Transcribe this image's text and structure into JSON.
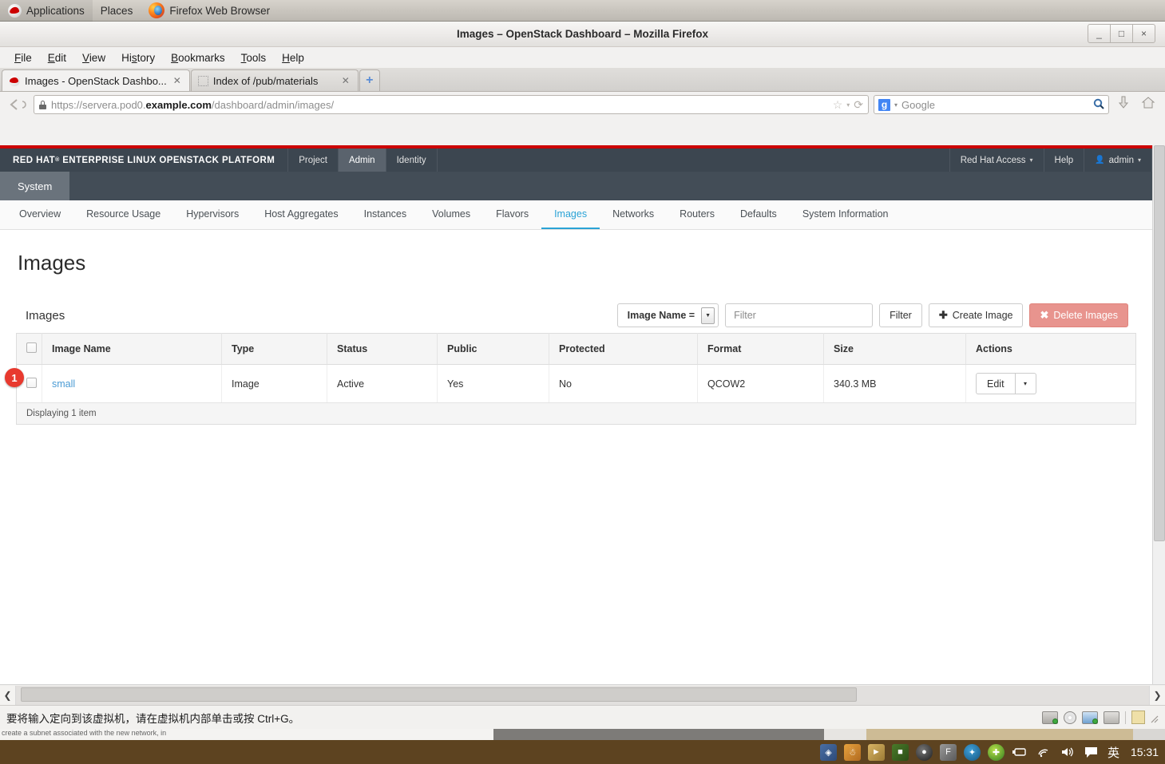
{
  "gnome_panel": {
    "applications": "Applications",
    "places": "Places",
    "active_window": "Firefox Web Browser",
    "logo_icon": "red-hat-icon",
    "firefox_icon": "firefox-icon"
  },
  "firefox": {
    "window_title": "Images – OpenStack Dashboard – Mozilla Firefox",
    "window_buttons": {
      "minimize": "_",
      "maximize": "□",
      "close": "×"
    },
    "menus": [
      "File",
      "Edit",
      "View",
      "History",
      "Bookmarks",
      "Tools",
      "Help"
    ],
    "tabs": [
      {
        "title": "Images - OpenStack Dashbo...",
        "close": "✕",
        "favicon": "red-hat-favicon",
        "active": true
      },
      {
        "title": "Index of /pub/materials",
        "close": "✕",
        "favicon": "blank-favicon",
        "active": false
      }
    ],
    "new_tab_label": "+",
    "url": {
      "scheme": "https://",
      "host_prefix": "servera.pod0.",
      "host_bold": "example.com",
      "path": "/dashboard/admin/images/",
      "lock": "lock-icon"
    },
    "search": {
      "engine": "g",
      "placeholder": "Google",
      "value": ""
    },
    "icons": {
      "back": "back-arrow-icon",
      "star": "☆",
      "reload": "⟳",
      "download": "⬇",
      "home": "⌂",
      "magnifier": "⚲"
    }
  },
  "dashboard": {
    "brand": {
      "redhat": "RED HAT",
      "sup": "®",
      "rest": "ENTERPRISE LINUX OPENSTACK PLATFORM"
    },
    "top_nav": [
      {
        "label": "Project",
        "active": false
      },
      {
        "label": "Admin",
        "active": true
      },
      {
        "label": "Identity",
        "active": false
      }
    ],
    "right_nav": [
      {
        "label": "Red Hat Access",
        "caret": "⌄"
      },
      {
        "label": "Help",
        "caret": ""
      },
      {
        "label": "admin",
        "caret": "⌄",
        "icon": "user-icon"
      }
    ],
    "context_label": "System",
    "sub_nav": [
      {
        "label": "Overview",
        "active": false
      },
      {
        "label": "Resource Usage",
        "active": false
      },
      {
        "label": "Hypervisors",
        "active": false
      },
      {
        "label": "Host Aggregates",
        "active": false
      },
      {
        "label": "Instances",
        "active": false
      },
      {
        "label": "Volumes",
        "active": false
      },
      {
        "label": "Flavors",
        "active": false
      },
      {
        "label": "Images",
        "active": true
      },
      {
        "label": "Networks",
        "active": false
      },
      {
        "label": "Routers",
        "active": false
      },
      {
        "label": "Defaults",
        "active": false
      },
      {
        "label": "System Information",
        "active": false
      }
    ],
    "page_title": "Images",
    "panel_title": "Images",
    "toolbar": {
      "filter_select_label": "Image Name =",
      "filter_placeholder": "Filter",
      "filter_value": "",
      "filter_button": "Filter",
      "create_button": "Create Image",
      "create_icon": "✚",
      "delete_button": "Delete Images",
      "delete_icon": "✖"
    },
    "table": {
      "columns": [
        "Image Name",
        "Type",
        "Status",
        "Public",
        "Protected",
        "Format",
        "Size",
        "Actions"
      ],
      "rows": [
        {
          "name": "small",
          "type": "Image",
          "status": "Active",
          "public": "Yes",
          "protected": "No",
          "format": "QCOW2",
          "size": "340.3 MB",
          "action_label": "Edit",
          "action_caret": "▾"
        }
      ],
      "footer": "Displaying 1 item"
    },
    "annotation_badge": "1"
  },
  "viewer": {
    "status_message": "要将输入定向到该虚拟机，请在虚拟机内部单击或按 Ctrl+G。",
    "tray_icons": [
      "disk-icon",
      "cdrom-icon",
      "network-icon",
      "camera-icon",
      "note-icon",
      "resize-grip-icon"
    ]
  },
  "background_window_text": "create a subnet associated with the new network, in",
  "taskbar": {
    "clock": "15:31",
    "ime_label": "英",
    "icons": [
      "blue-app-icon",
      "qq-penguin-icon",
      "file-share-icon",
      "nvidia-icon",
      "disc-burner-icon",
      "f-app-icon",
      "crystal-icon",
      "update-icon",
      "battery-icon",
      "wifi-icon",
      "volume-icon",
      "chat-icon"
    ]
  }
}
